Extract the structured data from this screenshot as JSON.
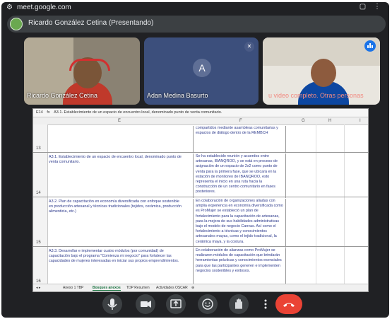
{
  "browser": {
    "url": "meet.google.com"
  },
  "meeting": {
    "presenter_title": "Ricardo González Cetina (Presentando)"
  },
  "participants": [
    {
      "name": "Ricardo González Cetina"
    },
    {
      "name": "Adan Medina Basurto",
      "initial": "A"
    },
    {
      "message": "u video completo. Otras personas"
    }
  ],
  "spreadsheet": {
    "name_box": "E14",
    "formula": "A3.1. Establecimiento de un espacio de encuentro local, denominado punto de venta comunitario.",
    "columns": [
      "E",
      "F",
      "G",
      "H",
      "I"
    ],
    "rows": [
      {
        "num": "13",
        "e": "",
        "f": "compartidos mediante asambleas comunitarias y espacios de diálogo dentro de la REMBCH"
      },
      {
        "num": "14",
        "e": "A3.1. Establecimiento de un espacio de encuentro local, denominado punto de venta comunitario.",
        "f": "Se ha establecido reunión y acuerdos entre artesanas, IBANQROO, y se está en proceso de asignación de un espacio de 2x2 como punto de venta para la primera fase, que se ubicará en la estación de monitoreo de IBANQROO, esto representa el inicio en una ruta hacia la construcción de un centro comunitario en fases posteriores."
      },
      {
        "num": "15",
        "e": "A3.2. Plan de capacitación en economía diversificada con enfoque sostenible en producción artesanal y técnicas tradicionales (tejidos, cerámica, producción alimenticia, etc.)",
        "f": "En colaboración de organizaciones aliadas con amplia experiencia en economía diversificada como es ProMujer se estableció un plan de fortalecimiento para la capacitación de artesanas, para la mejora de sus habilidades administrativas bajo el modelo de negocio Canvas. Así como el fortalecimiento a técnicas y conocimientos artesanales mayas, como el tejido tradicional, la cerámica maya, y la costura."
      },
      {
        "num": "16",
        "e": "A3.3. Desarrollar e implementar cuatro módulos (por comunidad) de capacitación bajo el programa \"Comienza mi negocio\" para fortalecer las capacidades de mujeres interesadas en iniciar sus propios emprendimientos.",
        "f": "En colaboración de alianzas como ProMujer se realizaron módulos de capacitación que brindarán herramientas prácticas y conocimientos esenciales para que las participantes generen e implementen negocios sostenibles y exitosos."
      }
    ],
    "sheet_tabs": [
      "Anexo 1 TBP",
      "Bosques anexos",
      "TDP Resumen",
      "Actividades OSCAR"
    ],
    "active_tab": "Bosques anexos"
  },
  "controls": [
    {
      "name": "mic",
      "icon": "mic-icon"
    },
    {
      "name": "camera",
      "icon": "camera-icon"
    },
    {
      "name": "present",
      "icon": "present-icon"
    },
    {
      "name": "reactions",
      "icon": "emoji-icon"
    },
    {
      "name": "raise-hand",
      "icon": "hand-icon"
    },
    {
      "name": "more",
      "icon": "more-vert-icon"
    },
    {
      "name": "leave",
      "icon": "call-end-icon"
    }
  ],
  "colors": {
    "leave": "#ea4335",
    "background": "#202124",
    "tile_blue": "#3c4f7c",
    "sheet_text": "#2d3a8c"
  }
}
